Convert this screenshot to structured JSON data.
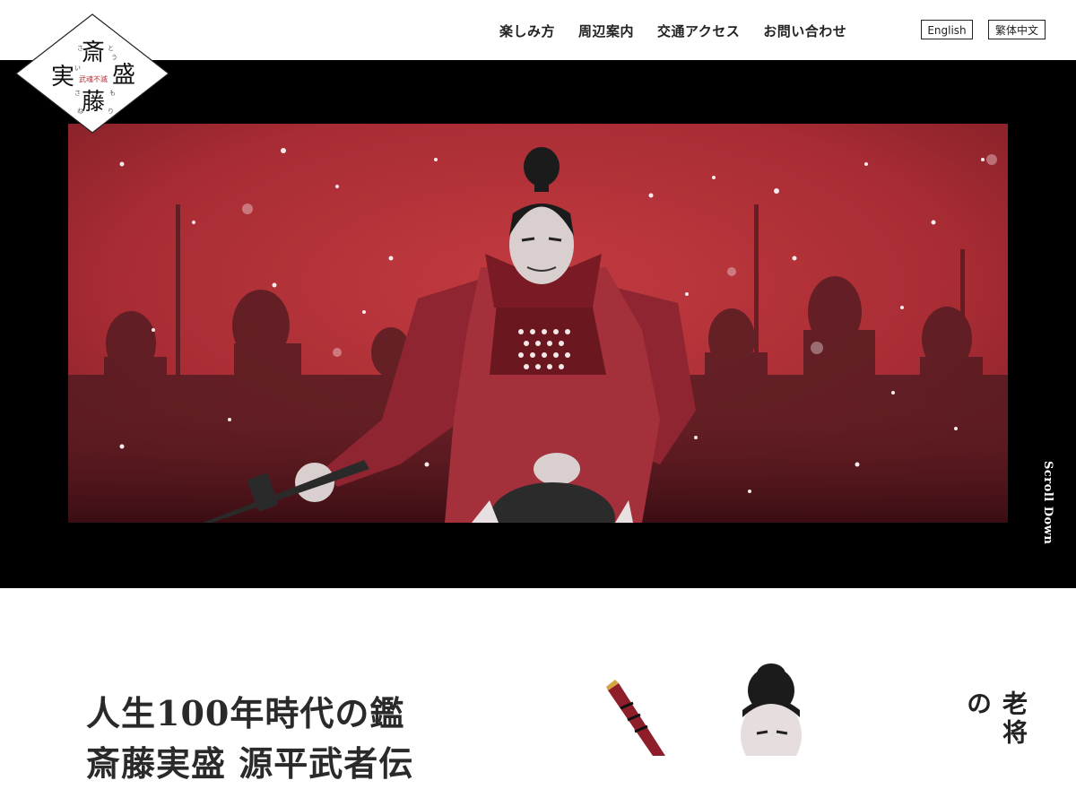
{
  "nav": {
    "items": [
      "楽しみ方",
      "周辺案内",
      "交通アクセス",
      "お問い合わせ"
    ]
  },
  "lang": {
    "english": "English",
    "traditional_chinese": "繁体中文"
  },
  "logo": {
    "main_chars": [
      "斎",
      "実",
      "盛",
      "藤"
    ],
    "subtitle": "武魂不滅",
    "kana": [
      "さ",
      "い",
      "と",
      "う",
      "さ",
      "ね",
      "も",
      "り"
    ]
  },
  "hero": {
    "scroll_label": "Scroll Down"
  },
  "section": {
    "headline_line1": "人生100年時代の鑑",
    "headline_line2": "斎藤実盛 源平武者伝",
    "vertical_text": "老将の"
  },
  "colors": {
    "hero_bg": "#000000",
    "hero_red": "#b8323a",
    "accent_red": "#c0392b",
    "text": "#222222"
  },
  "icons": [
    "scroll-indicator"
  ]
}
